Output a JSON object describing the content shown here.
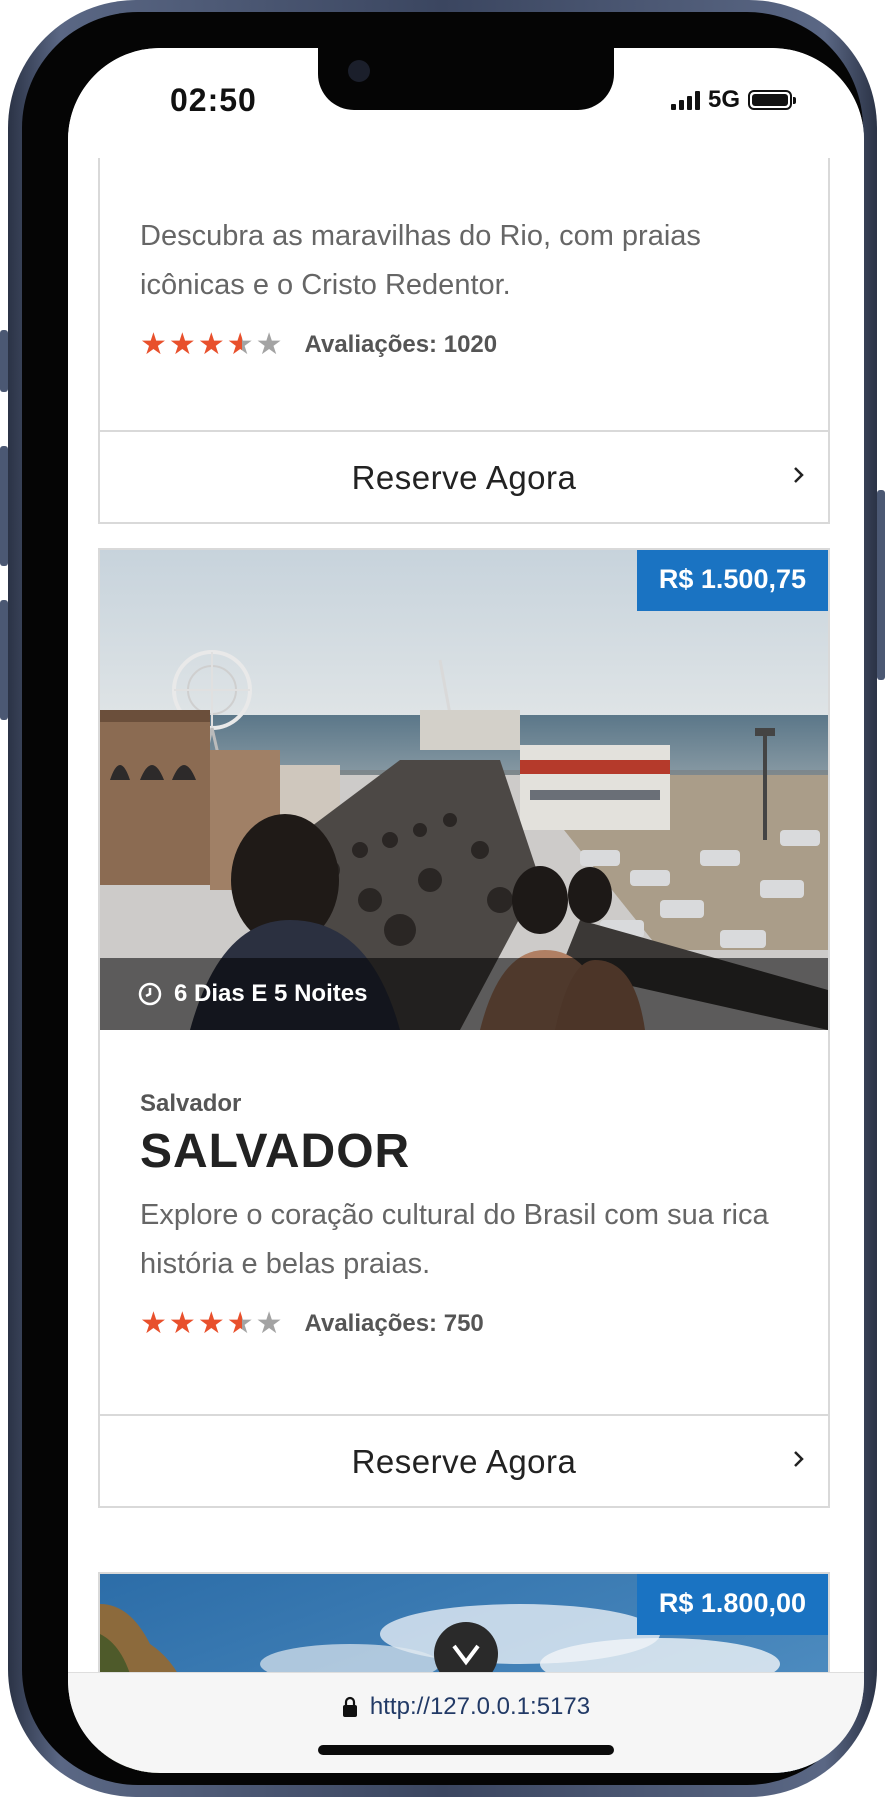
{
  "status_bar": {
    "time": "02:50",
    "network": "5G"
  },
  "cards": [
    {
      "description": "Descubra as maravilhas do Rio, com praias icônicas e o Cristo Redentor.",
      "rating_stars": 3.5,
      "reviews": "Avaliações: 1020",
      "book_label": "Reserve Agora"
    },
    {
      "price": "R$ 1.500,75",
      "duration": "6 Dias E 5 Noites",
      "subtitle": "Salvador",
      "title": "SALVADOR",
      "description": "Explore o coração cultural do Brasil com sua rica história e belas praias.",
      "rating_stars": 3.5,
      "reviews": "Avaliações: 750",
      "book_label": "Reserve Agora"
    },
    {
      "price": "R$ 1.800,00"
    }
  ],
  "browser": {
    "url": "http://127.0.0.1:5173"
  },
  "colors": {
    "accent": "#1a73c2",
    "star": "#e8502c",
    "star_empty": "#a3a3a3"
  }
}
